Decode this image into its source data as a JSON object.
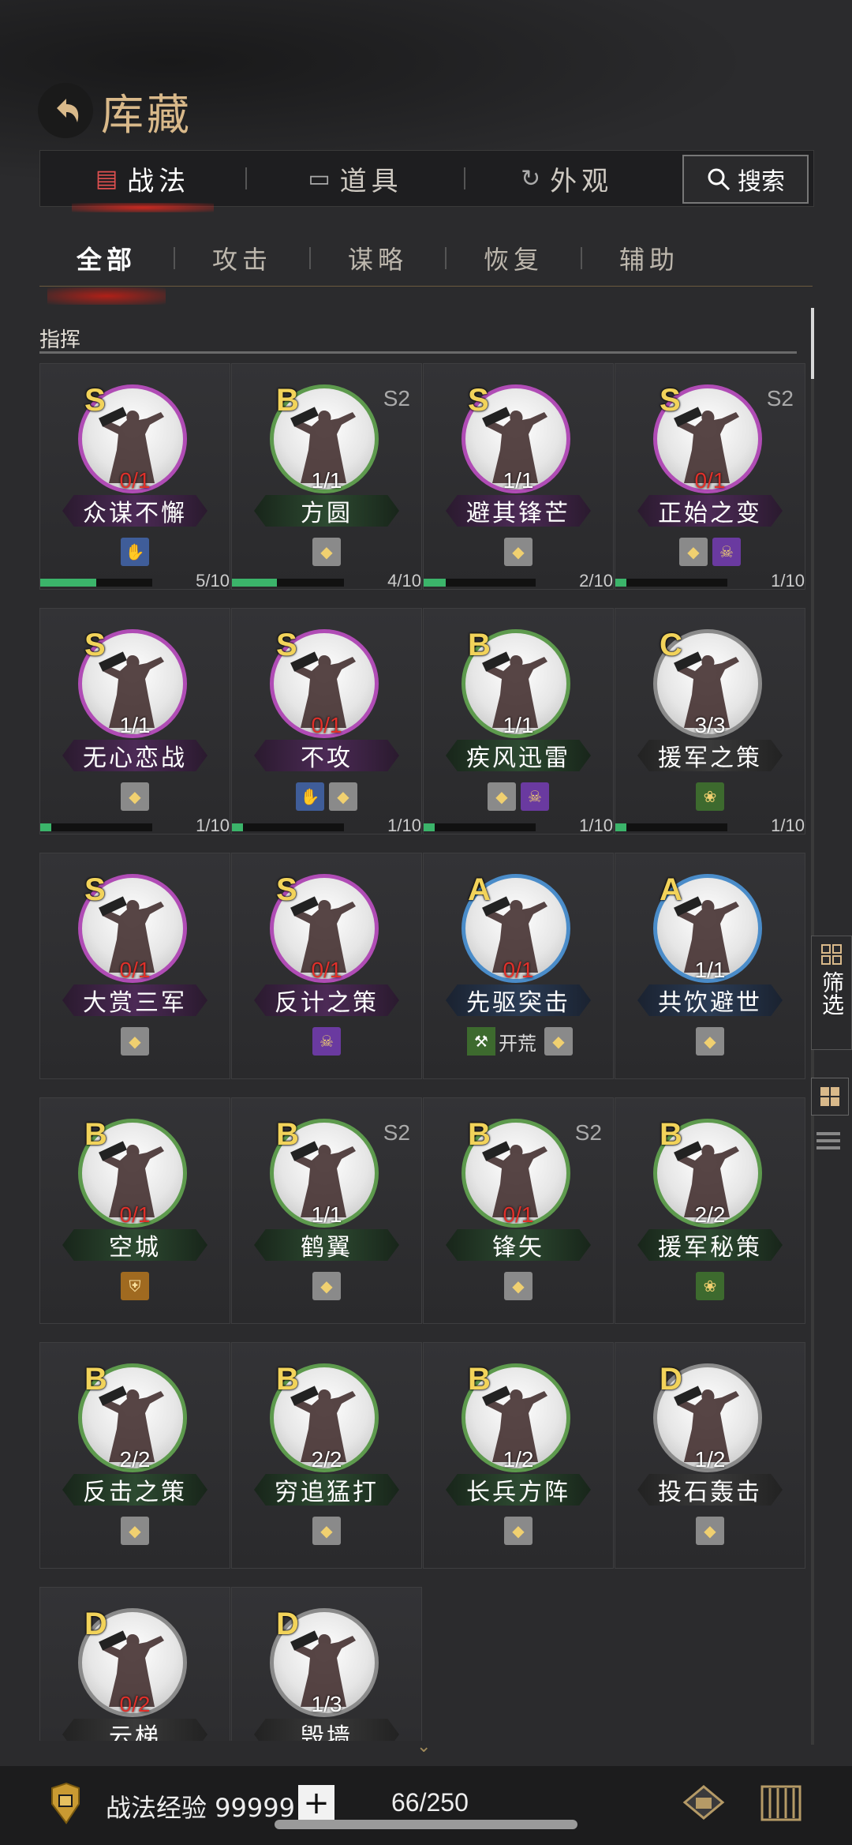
{
  "header": {
    "title": "库藏"
  },
  "main_tabs": [
    {
      "label": "战法",
      "icon": "scroll-bundle-icon",
      "active": true
    },
    {
      "label": "道具",
      "icon": "chest-icon",
      "active": false
    },
    {
      "label": "外观",
      "icon": "refresh-icon",
      "active": false
    }
  ],
  "search": {
    "label": "搜索"
  },
  "sub_tabs": [
    {
      "label": "全部",
      "active": true
    },
    {
      "label": "攻击",
      "active": false
    },
    {
      "label": "谋略",
      "active": false
    },
    {
      "label": "恢复",
      "active": false
    },
    {
      "label": "辅助",
      "active": false
    }
  ],
  "section": {
    "title": "指挥"
  },
  "cards": [
    {
      "name": "众谋不懈",
      "grade": "S",
      "season": "",
      "count": "0/1",
      "zero": true,
      "tags": [
        "hand"
      ],
      "progress_text": "5/10",
      "progress": 0.5
    },
    {
      "name": "方圆",
      "grade": "B",
      "season": "S2",
      "count": "1/1",
      "zero": false,
      "tags": [
        "bag"
      ],
      "progress_text": "4/10",
      "progress": 0.4
    },
    {
      "name": "避其锋芒",
      "grade": "S",
      "season": "",
      "count": "1/1",
      "zero": false,
      "tags": [
        "bag"
      ],
      "progress_text": "2/10",
      "progress": 0.2
    },
    {
      "name": "正始之变",
      "grade": "S",
      "season": "S2",
      "count": "0/1",
      "zero": true,
      "tags": [
        "bag",
        "skull"
      ],
      "progress_text": "1/10",
      "progress": 0.1
    },
    {
      "name": "无心恋战",
      "grade": "S",
      "season": "",
      "count": "1/1",
      "zero": false,
      "tags": [
        "bag"
      ],
      "progress_text": "1/10",
      "progress": 0.1
    },
    {
      "name": "不攻",
      "grade": "S",
      "season": "",
      "count": "0/1",
      "zero": true,
      "tags": [
        "hand",
        "bag"
      ],
      "progress_text": "1/10",
      "progress": 0.1
    },
    {
      "name": "疾风迅雷",
      "grade": "B",
      "season": "",
      "count": "1/1",
      "zero": false,
      "tags": [
        "bag",
        "skull"
      ],
      "progress_text": "1/10",
      "progress": 0.1
    },
    {
      "name": "援军之策",
      "grade": "C",
      "season": "",
      "count": "3/3",
      "zero": false,
      "tags": [
        "green"
      ],
      "progress_text": "1/10",
      "progress": 0.1
    },
    {
      "name": "大赏三军",
      "grade": "S",
      "season": "",
      "count": "0/1",
      "zero": true,
      "tags": [
        "bag"
      ],
      "progress_text": "",
      "progress": null
    },
    {
      "name": "反计之策",
      "grade": "S",
      "season": "",
      "count": "0/1",
      "zero": true,
      "tags": [
        "skull"
      ],
      "progress_text": "",
      "progress": null
    },
    {
      "name": "先驱突击",
      "grade": "A",
      "season": "",
      "count": "0/1",
      "zero": true,
      "tags": [
        "kaihuang",
        "bag"
      ],
      "kaihuang_label": "开荒",
      "progress_text": "",
      "progress": null
    },
    {
      "name": "共饮避世",
      "grade": "A",
      "season": "",
      "count": "1/1",
      "zero": false,
      "tags": [
        "bag"
      ],
      "progress_text": "",
      "progress": null
    },
    {
      "name": "空城",
      "grade": "B",
      "season": "",
      "count": "0/1",
      "zero": true,
      "tags": [
        "shield"
      ],
      "progress_text": "",
      "progress": null
    },
    {
      "name": "鹤翼",
      "grade": "B",
      "season": "S2",
      "count": "1/1",
      "zero": false,
      "tags": [
        "bag"
      ],
      "progress_text": "",
      "progress": null
    },
    {
      "name": "锋矢",
      "grade": "B",
      "season": "S2",
      "count": "0/1",
      "zero": true,
      "tags": [
        "bag"
      ],
      "progress_text": "",
      "progress": null
    },
    {
      "name": "援军秘策",
      "grade": "B",
      "season": "",
      "count": "2/2",
      "zero": false,
      "tags": [
        "green"
      ],
      "progress_text": "",
      "progress": null
    },
    {
      "name": "反击之策",
      "grade": "B",
      "season": "",
      "count": "2/2",
      "zero": false,
      "tags": [
        "bag"
      ],
      "progress_text": "",
      "progress": null
    },
    {
      "name": "穷追猛打",
      "grade": "B",
      "season": "",
      "count": "2/2",
      "zero": false,
      "tags": [
        "bag"
      ],
      "progress_text": "",
      "progress": null
    },
    {
      "name": "长兵方阵",
      "grade": "B",
      "season": "",
      "count": "1/2",
      "zero": false,
      "tags": [
        "bag"
      ],
      "progress_text": "",
      "progress": null
    },
    {
      "name": "投石轰击",
      "grade": "D",
      "season": "",
      "count": "1/2",
      "zero": false,
      "tags": [
        "bag"
      ],
      "progress_text": "",
      "progress": null
    },
    {
      "name": "云梯",
      "grade": "D",
      "season": "",
      "count": "0/2",
      "zero": true,
      "tags": [],
      "progress_text": "",
      "progress": null
    },
    {
      "name": "毁墙",
      "grade": "D",
      "season": "",
      "count": "1/3",
      "zero": false,
      "tags": [],
      "progress_text": "",
      "progress": null
    }
  ],
  "side": {
    "filter_label": "筛选"
  },
  "footer": {
    "exp_label": "战法经验 99999",
    "plus_label": "+",
    "capacity": "66/250"
  },
  "colors": {
    "accent_gold": "#d9b98a",
    "grade_gold": "#f2d35a",
    "zero_red": "#e0302a",
    "progress_green": "#3bb46a"
  }
}
